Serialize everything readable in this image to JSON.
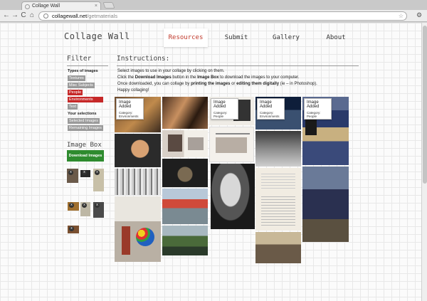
{
  "browser": {
    "tab_title": "Collage Wall",
    "tab_close": "×",
    "url_host": "collagewall.net",
    "url_path": "/getmaterials",
    "back": "←",
    "forward": "→",
    "reload": "C",
    "home": "⌂",
    "star": "☆",
    "wrench": "🔧"
  },
  "site": {
    "title": "Collage Wall",
    "nav": [
      "Resources",
      "Submit",
      "Gallery",
      "About"
    ],
    "active_nav": "Resources"
  },
  "sidebar": {
    "filter_heading": "Filter",
    "types_label": "Types of images",
    "types": [
      {
        "label": "Textures",
        "selected": false
      },
      {
        "label": "Misc Subjects",
        "selected": false
      },
      {
        "label": "People",
        "selected": true
      },
      {
        "label": "Environments",
        "selected": true
      },
      {
        "label": "Text",
        "selected": false
      }
    ],
    "selections_label": "Your selections",
    "selections": [
      "Selected Images",
      "Remaining Images"
    ],
    "image_box_heading": "Image Box",
    "download_button": "Download Images",
    "box_badge": "x"
  },
  "instructions": {
    "heading": "Instructions:",
    "line1": "Select images to use in your collage by clicking on them.",
    "line2_pre": "Click the ",
    "line2_b1": "Download Images",
    "line2_mid": " button in the ",
    "line2_b2": "Image Box",
    "line2_post": " to download the images to your computer.",
    "line3_pre": "Once downloaded, you can collage by ",
    "line3_b1": "printing the images",
    "line3_mid": " or ",
    "line3_b2": "editing them digitally",
    "line3_post": " (ie – in Photoshop).",
    "line4": "Happy collaging!"
  },
  "cards": [
    {
      "title": "Image Added",
      "category": "Category:\nEnvironments"
    },
    {
      "title": "Image Added",
      "category": "Category:\nPeople"
    },
    {
      "title": "Image Added",
      "category": "Category:\nEnvironments"
    },
    {
      "title": "Image Added",
      "category": "Category:\nPeople"
    }
  ],
  "colors": {
    "accent": "#c62828",
    "download_green": "#2e8b2e"
  }
}
